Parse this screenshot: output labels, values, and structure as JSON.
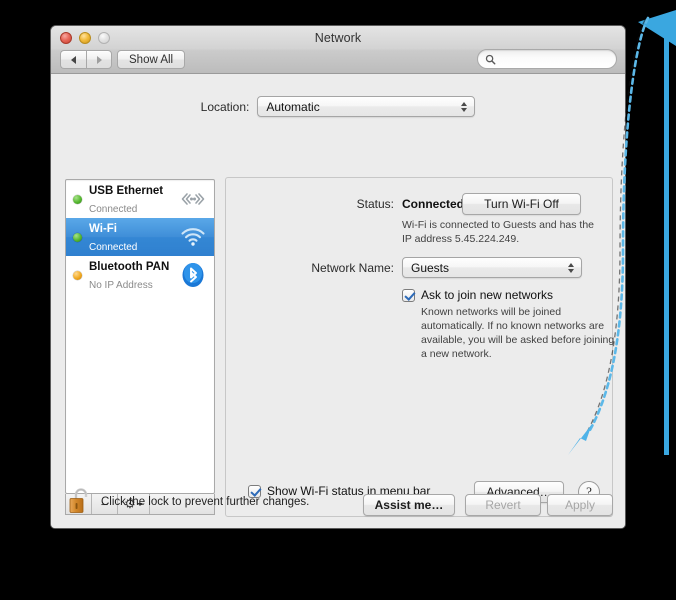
{
  "window": {
    "title": "Network",
    "traffic_lights": [
      "close",
      "minimize",
      "zoom"
    ],
    "toolbar": {
      "back_label": "◀",
      "forward_label": "▶",
      "show_all_label": "Show All",
      "search_placeholder": ""
    }
  },
  "location": {
    "label": "Location:",
    "value": "Automatic"
  },
  "sidebar": {
    "services": [
      {
        "name": "USB Ethernet",
        "status": "Connected",
        "dot": "green",
        "icon": "ethernet-icon",
        "selected": false
      },
      {
        "name": "Wi-Fi",
        "status": "Connected",
        "dot": "green",
        "icon": "wifi-icon",
        "selected": true
      },
      {
        "name": "Bluetooth PAN",
        "status": "No IP Address",
        "dot": "amber",
        "icon": "bluetooth-icon",
        "selected": false
      }
    ],
    "toolbar": {
      "add_label": "+",
      "remove_label": "−",
      "action_label": "⚙"
    }
  },
  "main": {
    "status_label": "Status:",
    "status_value": "Connected",
    "turn_wifi_off_label": "Turn Wi‑Fi Off",
    "status_description": "Wi‑Fi is connected to Guests and has the IP address 5.45.224.249.",
    "network_name_label": "Network Name:",
    "network_name_value": "Guests",
    "ask_join_label": "Ask to join new networks",
    "ask_join_checked": true,
    "ask_join_help": "Known networks will be joined automatically. If no known networks are available, you will be asked before joining a new network.",
    "show_status_label": "Show Wi‑Fi status in menu bar",
    "show_status_checked": true,
    "advanced_label": "Advanced…",
    "help_label": "?"
  },
  "footer": {
    "lock_icon": "unlocked-padlock-icon",
    "lock_text": "Click the lock to prevent further changes.",
    "assist_label": "Assist me…",
    "revert_label": "Revert",
    "revert_disabled": true,
    "apply_label": "Apply",
    "apply_disabled": true
  },
  "annotations": {
    "arrow_color": "#4fb3e8",
    "arrow_target": "advanced-button"
  },
  "colors": {
    "desktop_background": "#000000",
    "selection_blue": "#3487d4",
    "accent_arrow": "#4fb3e8",
    "window_background": "#ececec"
  }
}
